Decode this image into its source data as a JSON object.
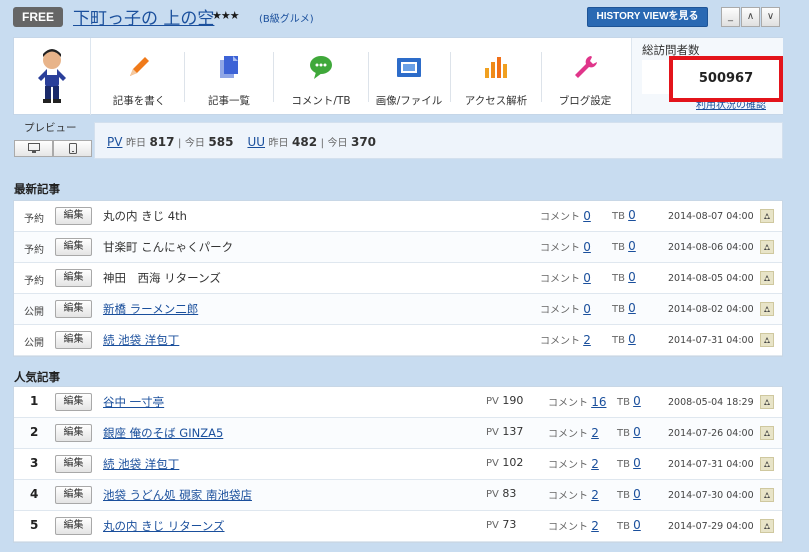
{
  "header": {
    "plan_badge": "FREE",
    "blog_title": "下町っ子の 上の空",
    "stars": "★★★",
    "category": "(B級グルメ)",
    "history_button": "HISTORY VIEWを見る",
    "win_minimize": "_",
    "win_up": "∧",
    "win_down": "∨"
  },
  "actions": [
    {
      "label": "記事を書く",
      "icon": "pencil-icon"
    },
    {
      "label": "記事一覧",
      "icon": "document-icon"
    },
    {
      "label": "コメント/TB",
      "icon": "speech-bubble-icon"
    },
    {
      "label": "画像/ファイル",
      "icon": "image-folder-icon"
    },
    {
      "label": "アクセス解析",
      "icon": "bar-chart-icon"
    },
    {
      "label": "ブログ設定",
      "icon": "wrench-icon"
    }
  ],
  "visits": {
    "title": "総訪問者数",
    "count": "500967",
    "usage_link": "利用状況の確認"
  },
  "preview": {
    "label": "プレビュー",
    "pc_icon": "desktop-icon",
    "mobile_icon": "mobile-icon"
  },
  "stats": {
    "pv_label": "PV",
    "uu_label": "UU",
    "yesterday": "昨日",
    "today": "今日",
    "pv_yesterday": "817",
    "pv_today": "585",
    "uu_yesterday": "482",
    "uu_today": "370",
    "sep": "|"
  },
  "common": {
    "edit": "編集",
    "comment_label": "コメント",
    "tb_label": "TB",
    "pv_label": "PV"
  },
  "latest": {
    "title": "最新記事",
    "rows": [
      {
        "status": "予約",
        "title": "丸の内 きじ 4th",
        "comments": "0",
        "tb": "0",
        "date": "2014-08-07 04:00"
      },
      {
        "status": "予約",
        "title": "甘楽町 こんにゃくパーク",
        "comments": "0",
        "tb": "0",
        "date": "2014-08-06 04:00"
      },
      {
        "status": "予約",
        "title": "神田　西海 リターンズ",
        "comments": "0",
        "tb": "0",
        "date": "2014-08-05 04:00"
      },
      {
        "status": "公開",
        "title": "新橋 ラーメン二郎",
        "comments": "0",
        "tb": "0",
        "date": "2014-08-02 04:00"
      },
      {
        "status": "公開",
        "title": "続 池袋 洋包丁",
        "comments": "2",
        "tb": "0",
        "date": "2014-07-31 04:00"
      }
    ]
  },
  "popular": {
    "title": "人気記事",
    "rows": [
      {
        "rank": "1",
        "title": "谷中 一寸亭",
        "pv": "190",
        "comments": "16",
        "tb": "0",
        "date": "2008-05-04 18:29"
      },
      {
        "rank": "2",
        "title": "銀座 俺のそば GINZA5",
        "pv": "137",
        "comments": "2",
        "tb": "0",
        "date": "2014-07-26 04:00"
      },
      {
        "rank": "3",
        "title": "続 池袋 洋包丁",
        "pv": "102",
        "comments": "2",
        "tb": "0",
        "date": "2014-07-31 04:00"
      },
      {
        "rank": "4",
        "title": "池袋 うどん処 硯家 南池袋店",
        "pv": "83",
        "comments": "2",
        "tb": "0",
        "date": "2014-07-30 04:00"
      },
      {
        "rank": "5",
        "title": "丸の内 きじ リターンズ",
        "pv": "73",
        "comments": "2",
        "tb": "0",
        "date": "2014-07-29 04:00"
      }
    ]
  },
  "colors": {
    "background": "#c8dcf0",
    "accent_blue": "#2a69b3",
    "link": "#1a4f9c",
    "highlight_red": "#e3141b"
  }
}
